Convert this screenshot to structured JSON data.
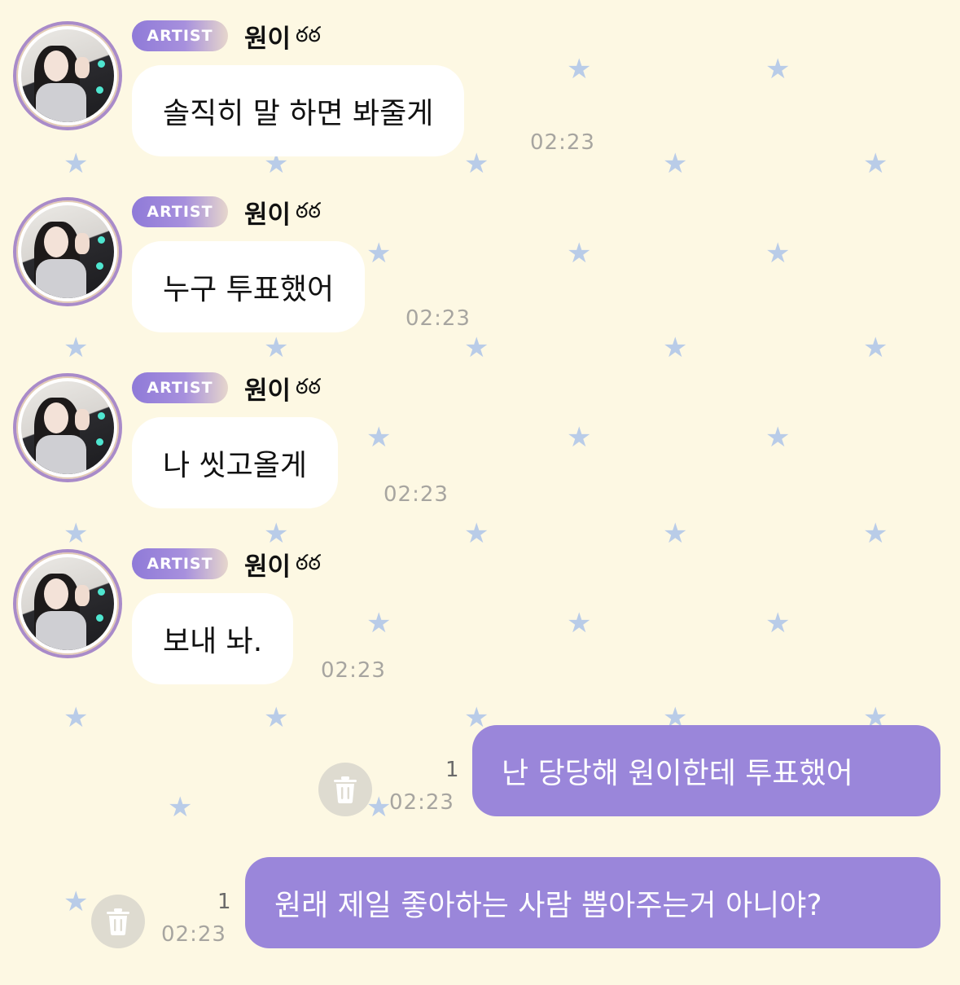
{
  "artist_label": "ARTIST",
  "sender_name": "원이",
  "sender_emoji": "ఠఠ",
  "incoming": [
    {
      "text": "솔직히 말 하면 봐줄게",
      "time": "02:23"
    },
    {
      "text": "누구 투표했어",
      "time": "02:23"
    },
    {
      "text": "나 씻고올게",
      "time": "02:23"
    },
    {
      "text": "보내 놔.",
      "time": "02:23"
    }
  ],
  "outgoing": [
    {
      "text": "난 당당해 원이한테 투표했어",
      "time": "02:23",
      "unread": "1"
    },
    {
      "text": "원래 제일 좋아하는 사람 뽑아주는거 아니야?",
      "time": "02:23",
      "unread": "1"
    }
  ],
  "icons": {
    "delete": "trash-icon",
    "background": "star-icon"
  },
  "colors": {
    "background": "#fdf8e3",
    "outgoing_bubble": "#9a86da",
    "badge": "#8f7ad8",
    "star": "#b9cce8"
  }
}
